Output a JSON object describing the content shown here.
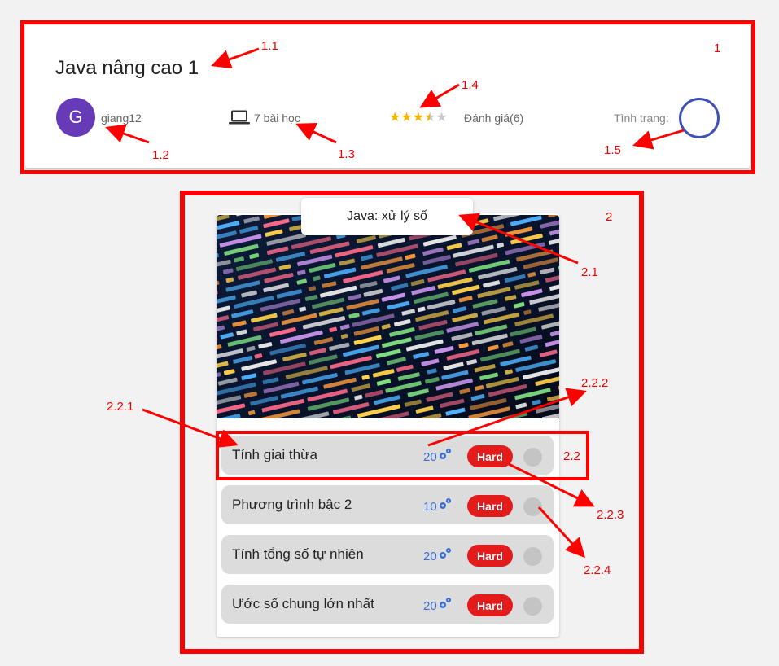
{
  "course": {
    "title": "Java nâng cao 1",
    "author_initial": "G",
    "author": "giang12",
    "lessons_icon": "laptop-icon",
    "lessons": "7 bài học",
    "rating_stars": 3.5,
    "rating_max": 5,
    "rating_text": "Đánh giá(6)",
    "status_label": "Tình trạng:",
    "accent_color": "#3f51b5",
    "avatar_color": "#673ab7"
  },
  "topic": {
    "title": "Java: xử lý số",
    "image": "code-screen-image",
    "exercises": [
      {
        "name": "Tính giai thừa",
        "points": "20",
        "difficulty": "Hard"
      },
      {
        "name": "Phương trình bậc 2",
        "points": "10",
        "difficulty": "Hard"
      },
      {
        "name": "Tính tổng số tự nhiên",
        "points": "20",
        "difficulty": "Hard"
      },
      {
        "name": "Ước số chung lớn nhất",
        "points": "20",
        "difficulty": "Hard"
      }
    ],
    "badge_color": "#e31b1b",
    "points_icon": "gears-icon"
  },
  "annotations": {
    "a1": "1",
    "a1_1": "1.1",
    "a1_2": "1.2",
    "a1_3": "1.3",
    "a1_4": "1.4",
    "a1_5": "1.5",
    "a2": "2",
    "a2_1": "2.1",
    "a2_2": "2.2",
    "a2_2_1": "2.2.1",
    "a2_2_2": "2.2.2",
    "a2_2_3": "2.2.3",
    "a2_2_4": "2.2.4",
    "color": "#ff0000"
  }
}
